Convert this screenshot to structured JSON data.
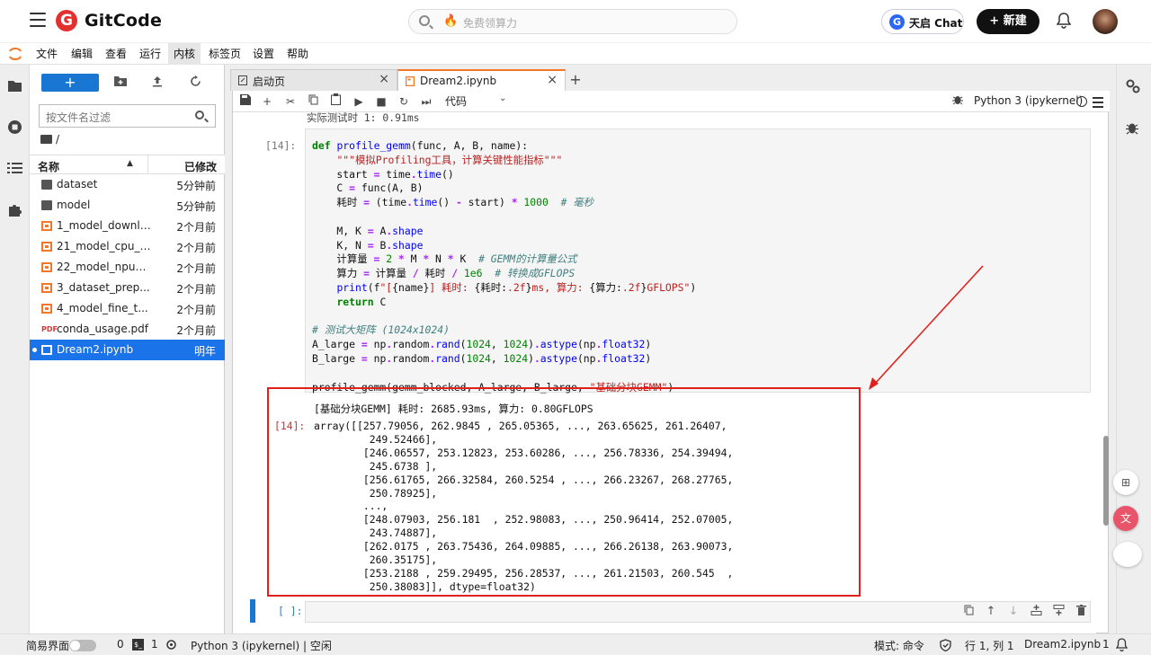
{
  "header": {
    "brand": "GitCode",
    "search_placeholder": "免费领算力",
    "chat_label": "天启 Chat",
    "new_label": "+ 新建"
  },
  "menu": [
    "文件",
    "编辑",
    "查看",
    "运行",
    "内核",
    "标签页",
    "设置",
    "帮助"
  ],
  "filebrowser": {
    "filter_placeholder": "按文件名过滤",
    "path": "/",
    "col_name": "名称",
    "col_modified": "已修改",
    "items": [
      {
        "name": "dataset",
        "modified": "5分钟前",
        "type": "folder"
      },
      {
        "name": "model",
        "modified": "5分钟前",
        "type": "folder"
      },
      {
        "name": "1_model_downlo...",
        "modified": "2个月前",
        "type": "notebook"
      },
      {
        "name": "21_model_cpu_i...",
        "modified": "2个月前",
        "type": "notebook"
      },
      {
        "name": "22_model_npu_i...",
        "modified": "2个月前",
        "type": "notebook"
      },
      {
        "name": "3_dataset_prep...",
        "modified": "2个月前",
        "type": "notebook"
      },
      {
        "name": "4_model_fine_t...",
        "modified": "2个月前",
        "type": "notebook"
      },
      {
        "name": "conda_usage.pdf",
        "modified": "2个月前",
        "type": "pdf"
      },
      {
        "name": "Dream2.ipynb",
        "modified": "明年",
        "type": "notebook",
        "selected": true
      }
    ]
  },
  "tabs": [
    {
      "label": "启动页",
      "active": false
    },
    {
      "label": "Dream2.ipynb",
      "active": true
    }
  ],
  "toolbar": {
    "cell_type": "代码",
    "kernel": "Python 3 (ipykernel)"
  },
  "cell": {
    "prev_output": "实际测试时 1: 0.91ms",
    "prompt": "[14]:",
    "out_prompt": "[14]:",
    "out_line1": "[基础分块GEMM] 耗时: 2685.93ms, 算力: 0.80GFLOPS",
    "array_lines": [
      "array([[257.79056, 262.9845 , 265.05365, ..., 263.65625, 261.26407,",
      "         249.52466],",
      "        [246.06557, 253.12823, 253.60286, ..., 256.78336, 254.39494,",
      "         245.6738 ],",
      "        [256.61765, 266.32584, 260.5254 , ..., 266.23267, 268.27765,",
      "         250.78925],",
      "        ...,",
      "        [248.07903, 256.181  , 252.98083, ..., 250.96414, 252.07005,",
      "         243.74887],",
      "        [262.0175 , 263.75436, 264.09885, ..., 266.26138, 263.90073,",
      "         260.35175],",
      "        [253.2188 , 259.29495, 256.28537, ..., 261.21503, 260.545  ,",
      "         250.38083]], dtype=float32)"
    ],
    "empty_prompt": "[ ]:"
  },
  "status": {
    "simple_mode": "简易界面",
    "count0": "0",
    "count1": "1",
    "kernel_status": "Python 3 (ipykernel) | 空闲",
    "mode": "模式: 命令",
    "position": "行 1, 列 1",
    "filename": "Dream2.ipynb",
    "notif_count": "1"
  },
  "colors": {
    "accent": "#1976d2",
    "brand": "#e3302f",
    "jupyter": "#f37726",
    "annotation": "#e0201a"
  }
}
